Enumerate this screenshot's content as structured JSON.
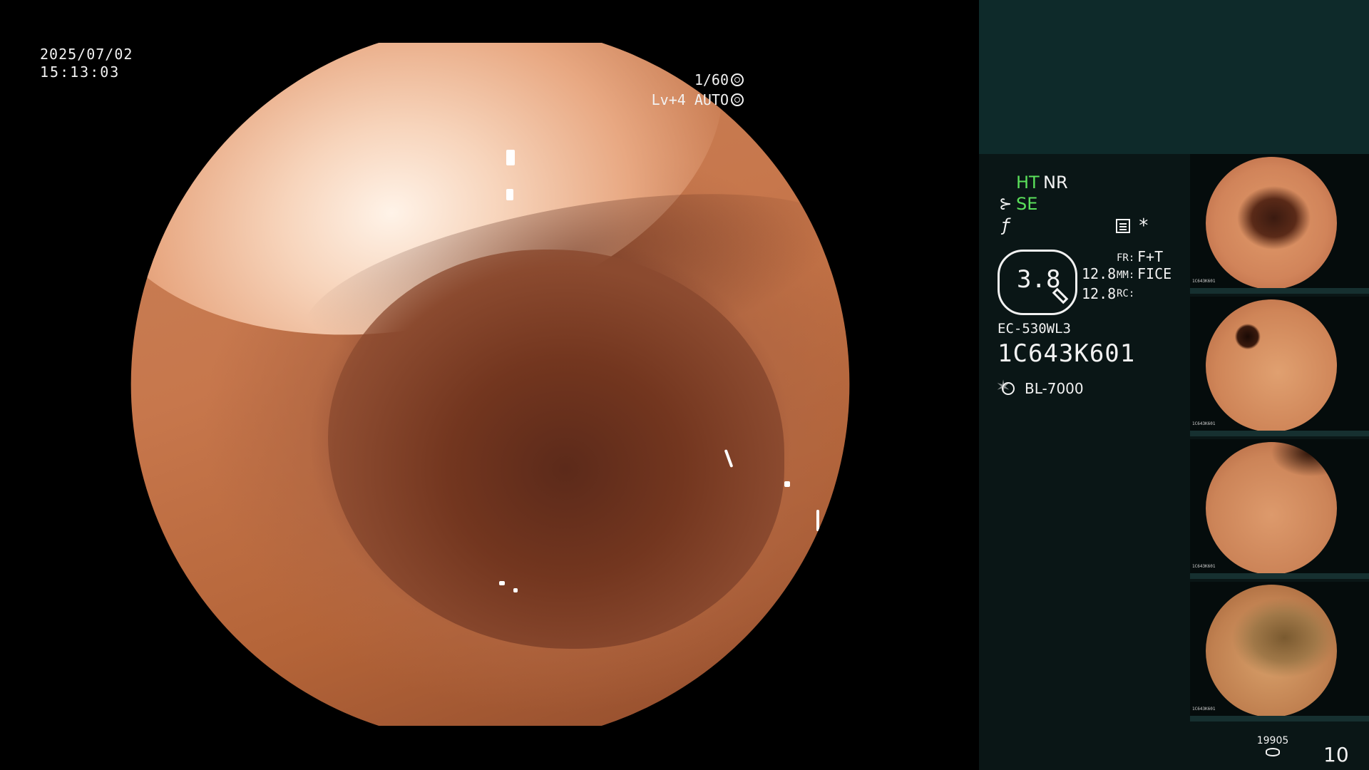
{
  "overlay": {
    "date": "2025/07/02",
    "time": "15:13:03",
    "shutter": "1/60",
    "level": "Lv+4 AUTO"
  },
  "side_panel": {
    "ht": "HT",
    "nr": "NR",
    "se": "SE",
    "zoom": "3.8",
    "num_top": "12.8",
    "num_bottom": "12.8",
    "fr_key": "FR:",
    "fr_value": "F+T",
    "mm_key": "MM:",
    "mm_value": "FICE",
    "rc_key": "RC:",
    "scope_model": "EC-530WL3",
    "serial": "1C643K601",
    "light_source": "BL-7000",
    "star": "*"
  },
  "thumbnails": [
    {
      "meta": "1C643K601"
    },
    {
      "meta": "1C643K601"
    },
    {
      "meta": "1C643K601"
    },
    {
      "meta": "1C643K601"
    }
  ],
  "footer": {
    "image_count": "19905",
    "page_number": "10"
  },
  "colors": {
    "mode_green": "#5be05b",
    "panel_bg": "#0a1616",
    "panel_top": "#0e2a2a"
  }
}
